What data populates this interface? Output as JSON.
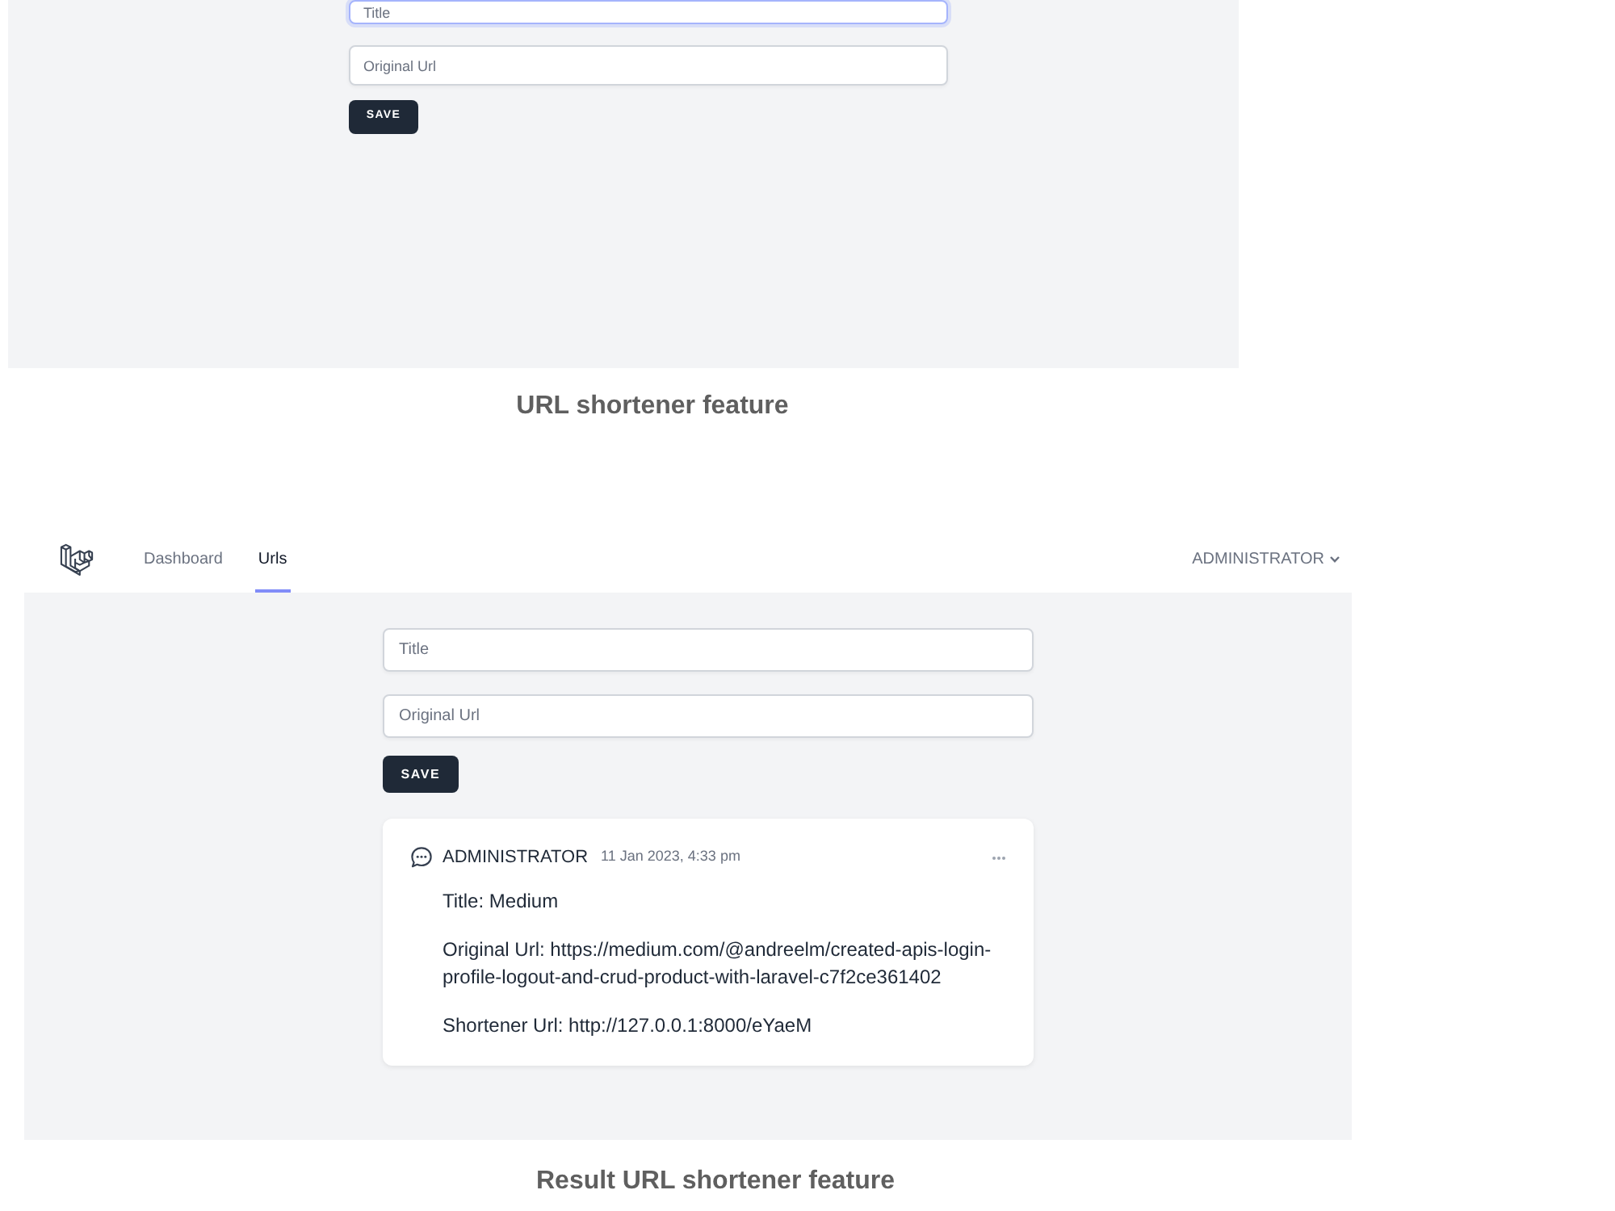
{
  "figures": [
    {
      "kind": "cropped",
      "screenshot": {
        "fields": [
          {
            "placeholder": "Title",
            "focused": true
          },
          {
            "placeholder": "Original Url",
            "focused": false
          }
        ],
        "save_button": "SAVE"
      },
      "caption": "URL shortener feature"
    },
    {
      "kind": "full",
      "screenshot": {
        "navbar": {
          "links": [
            {
              "label": "Dashboard",
              "selected": false
            },
            {
              "label": "Urls",
              "selected": true
            }
          ],
          "user_menu": "ADMINISTRATOR"
        },
        "fields": [
          {
            "placeholder": "Title",
            "focused": false
          },
          {
            "placeholder": "Original Url",
            "focused": false
          }
        ],
        "save_button": "SAVE",
        "posts": [
          {
            "author": "ADMINISTRATOR",
            "time": "11 Jan 2023, 4:33 pm",
            "lines": [
              "Title: Medium",
              "Original Url: https://medium.com/@andreelm/created-apis-login-profile-logout-and-crud-product-with-laravel-c7f2ce361402",
              "Shortener Url: http://127.0.0.1:8000/eYaeM"
            ]
          }
        ]
      },
      "caption": "Result URL shortener feature"
    }
  ]
}
